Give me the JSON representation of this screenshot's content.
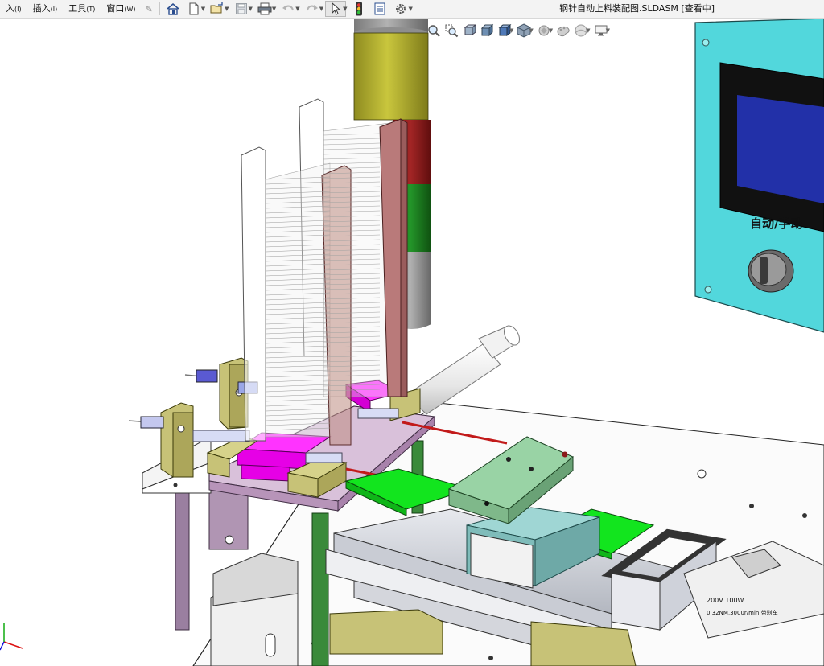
{
  "menu": {
    "items": [
      {
        "label": "入",
        "key": "(I)"
      },
      {
        "label": "插入",
        "key": "(I)"
      },
      {
        "label": "工具",
        "key": "(T)"
      },
      {
        "label": "窗口",
        "key": "(W)"
      }
    ]
  },
  "toolbar": {
    "icons": [
      "home-icon",
      "new-document-icon",
      "open-folder-icon",
      "save-icon",
      "print-icon",
      "undo-icon",
      "redo-icon",
      "select-arrow-icon",
      "traffic-light-icon",
      "file-properties-icon",
      "options-gear-icon"
    ]
  },
  "window": {
    "title": "钢针自动上料装配图.SLDASM [查看中]"
  },
  "control_panel": {
    "mode_label": "自动/手动"
  },
  "motor": {
    "label_line1": "200V 100W",
    "label_line2": "0.32NM,3000r/min 带刹车"
  },
  "colors": {
    "panel": "#52d7dc",
    "screen": "#2230a8",
    "magenta": "#e600e6",
    "green_plate": "#12e51e",
    "mint_block": "#99d3a5",
    "teal_block": "#9fd6d4",
    "gold": "#c7c277",
    "lavender": "#c7a6c8",
    "rose": "#b97a7a",
    "lamp_yellow": "#b7b431",
    "lamp_red": "#9c1d1d",
    "lamp_green": "#1e8a1e"
  }
}
